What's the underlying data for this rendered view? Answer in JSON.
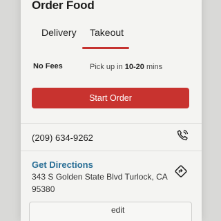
{
  "header": {
    "title": "Order Food"
  },
  "tabs": [
    {
      "label": "Delivery",
      "selected": false
    },
    {
      "label": "Takeout",
      "selected": true
    }
  ],
  "fees": {
    "no_fees_label": "No Fees",
    "pickup_prefix": "Pick up in ",
    "pickup_time": "10-20",
    "pickup_suffix": " mins"
  },
  "actions": {
    "start_order_label": "Start Order"
  },
  "contact": {
    "phone": "(209) 634-9262",
    "directions_label": "Get Directions",
    "address_line1": "343 S Golden State Blvd Turlock, CA",
    "address_line2": "95380"
  },
  "footer": {
    "partial_text": "edit"
  },
  "icons": {
    "phone": "phone-icon",
    "directions": "directions-icon"
  },
  "colors": {
    "accent": "#c8332f",
    "link": "#2a6f96"
  }
}
